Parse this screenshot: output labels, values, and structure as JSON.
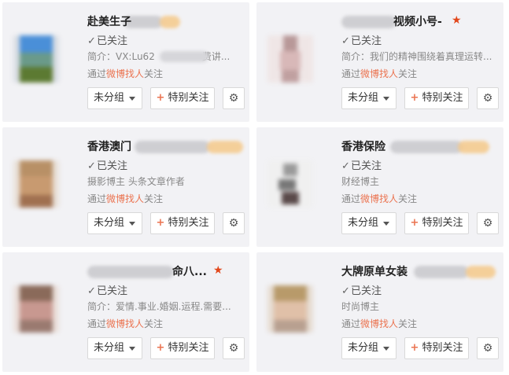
{
  "cards": [
    {
      "name": "赴美生子",
      "followed": "已关注",
      "line1_prefix": "简介：VX:Lu62",
      "line1_suffix": "费讲...",
      "via_prefix": "通过",
      "via_link": "微博找人",
      "via_suffix": "关注",
      "group_label": "未分组",
      "special_label": "特别关注",
      "has_star": false
    },
    {
      "name": "视频小号-",
      "followed": "已关注",
      "line1_prefix": "简介：我们的精神围绕着真理运转...",
      "line1_suffix": "",
      "via_prefix": "通过",
      "via_link": "微博找人",
      "via_suffix": "关注",
      "group_label": "未分组",
      "special_label": "特别关注",
      "has_star": true
    },
    {
      "name": "香港澳门",
      "followed": "已关注",
      "line1_prefix": "摄影博主 头条文章作者",
      "line1_suffix": "",
      "via_prefix": "通过",
      "via_link": "微博找人",
      "via_suffix": "关注",
      "group_label": "未分组",
      "special_label": "特别关注",
      "has_star": false
    },
    {
      "name": "香港保险",
      "followed": "已关注",
      "line1_prefix": "财经博主",
      "line1_suffix": "",
      "via_prefix": "通过",
      "via_link": "微博找人",
      "via_suffix": "关注",
      "group_label": "未分组",
      "special_label": "特别关注",
      "has_star": false
    },
    {
      "name": "命八...",
      "followed": "已关注",
      "line1_prefix": "简介：爱情.事业.婚姻.运程.需要...",
      "line1_suffix": "",
      "via_prefix": "通过",
      "via_link": "微博找人",
      "via_suffix": "关注",
      "group_label": "未分组",
      "special_label": "特别关注",
      "has_star": true
    },
    {
      "name": "大牌原单女装",
      "followed": "已关注",
      "line1_prefix": "时尚博主",
      "line1_suffix": "",
      "via_prefix": "通过",
      "via_link": "微博找人",
      "via_suffix": "关注",
      "group_label": "未分组",
      "special_label": "特别关注",
      "has_star": false
    }
  ],
  "icons": {
    "check": "check-icon",
    "plus": "plus-icon",
    "gear": "gear-icon",
    "caret": "caret-down-icon",
    "star": "star-icon"
  },
  "colors": {
    "card_bg": "#f2f2f5",
    "link": "#eb7350",
    "star": "#e2471b"
  }
}
